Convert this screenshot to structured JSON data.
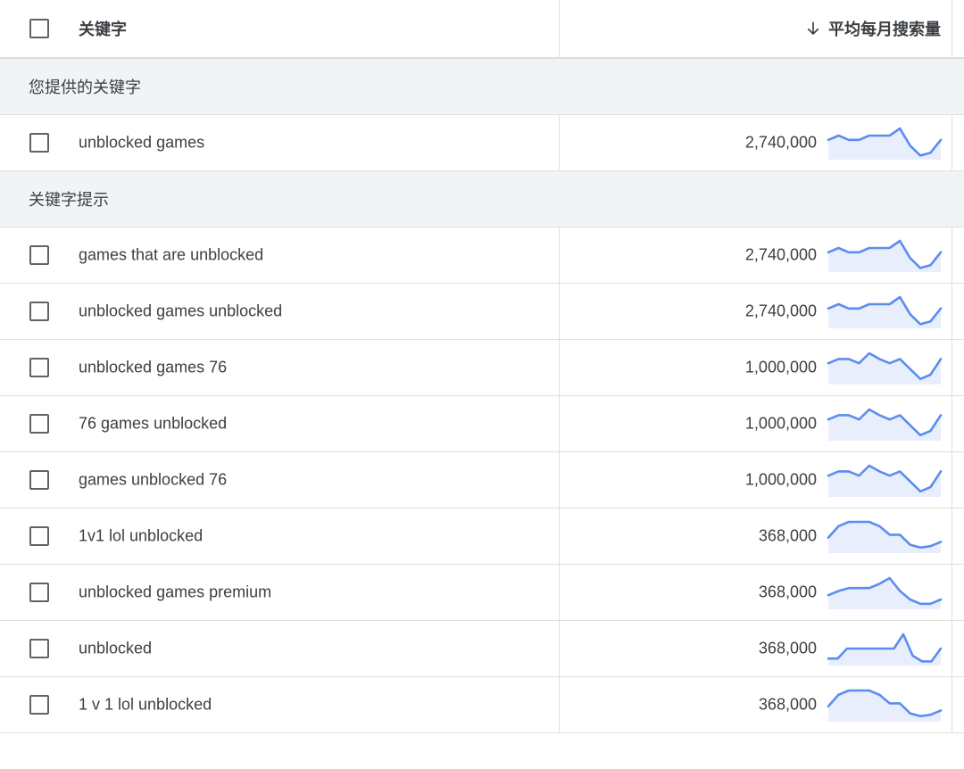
{
  "header": {
    "keyword_label": "关键字",
    "volume_label": "平均每月搜索量",
    "sort_icon": "arrow-down-icon"
  },
  "sections": [
    {
      "label": "您提供的关键字",
      "rows": [
        {
          "keyword": "unblocked games",
          "volume": "2,740,000",
          "trend": [
            0.6,
            0.75,
            0.6,
            0.6,
            0.75,
            0.75,
            0.75,
            1.0,
            0.4,
            0.05,
            0.15,
            0.6
          ]
        }
      ]
    },
    {
      "label": "关键字提示",
      "rows": [
        {
          "keyword": "games that are unblocked",
          "volume": "2,740,000",
          "trend": [
            0.6,
            0.75,
            0.6,
            0.6,
            0.75,
            0.75,
            0.75,
            1.0,
            0.4,
            0.05,
            0.15,
            0.6
          ]
        },
        {
          "keyword": "unblocked games unblocked",
          "volume": "2,740,000",
          "trend": [
            0.6,
            0.75,
            0.6,
            0.6,
            0.75,
            0.75,
            0.75,
            1.0,
            0.4,
            0.05,
            0.15,
            0.6
          ]
        },
        {
          "keyword": "unblocked games 76",
          "volume": "1,000,000",
          "trend": [
            0.65,
            0.8,
            0.8,
            0.65,
            1.0,
            0.8,
            0.65,
            0.8,
            0.45,
            0.1,
            0.25,
            0.8
          ]
        },
        {
          "keyword": "76 games unblocked",
          "volume": "1,000,000",
          "trend": [
            0.65,
            0.8,
            0.8,
            0.65,
            1.0,
            0.8,
            0.65,
            0.8,
            0.45,
            0.1,
            0.25,
            0.8
          ]
        },
        {
          "keyword": "games unblocked 76",
          "volume": "1,000,000",
          "trend": [
            0.65,
            0.8,
            0.8,
            0.65,
            1.0,
            0.8,
            0.65,
            0.8,
            0.45,
            0.1,
            0.25,
            0.8
          ]
        },
        {
          "keyword": "1v1 lol unblocked",
          "volume": "368,000",
          "trend": [
            0.45,
            0.85,
            1.0,
            1.0,
            1.0,
            0.85,
            0.55,
            0.55,
            0.2,
            0.1,
            0.15,
            0.3
          ]
        },
        {
          "keyword": "unblocked games premium",
          "volume": "368,000",
          "trend": [
            0.4,
            0.55,
            0.65,
            0.65,
            0.65,
            0.8,
            1.0,
            0.55,
            0.25,
            0.1,
            0.1,
            0.25
          ]
        },
        {
          "keyword": "unblocked",
          "volume": "368,000",
          "trend": [
            0.15,
            0.15,
            0.5,
            0.5,
            0.5,
            0.5,
            0.5,
            0.5,
            1.0,
            0.25,
            0.05,
            0.05,
            0.5
          ]
        },
        {
          "keyword": "1 v 1 lol unblocked",
          "volume": "368,000",
          "trend": [
            0.45,
            0.85,
            1.0,
            1.0,
            1.0,
            0.85,
            0.55,
            0.55,
            0.2,
            0.1,
            0.15,
            0.3
          ]
        }
      ]
    }
  ],
  "colors": {
    "sparkline_stroke": "#5b8def",
    "sparkline_fill": "#e8eefc"
  }
}
